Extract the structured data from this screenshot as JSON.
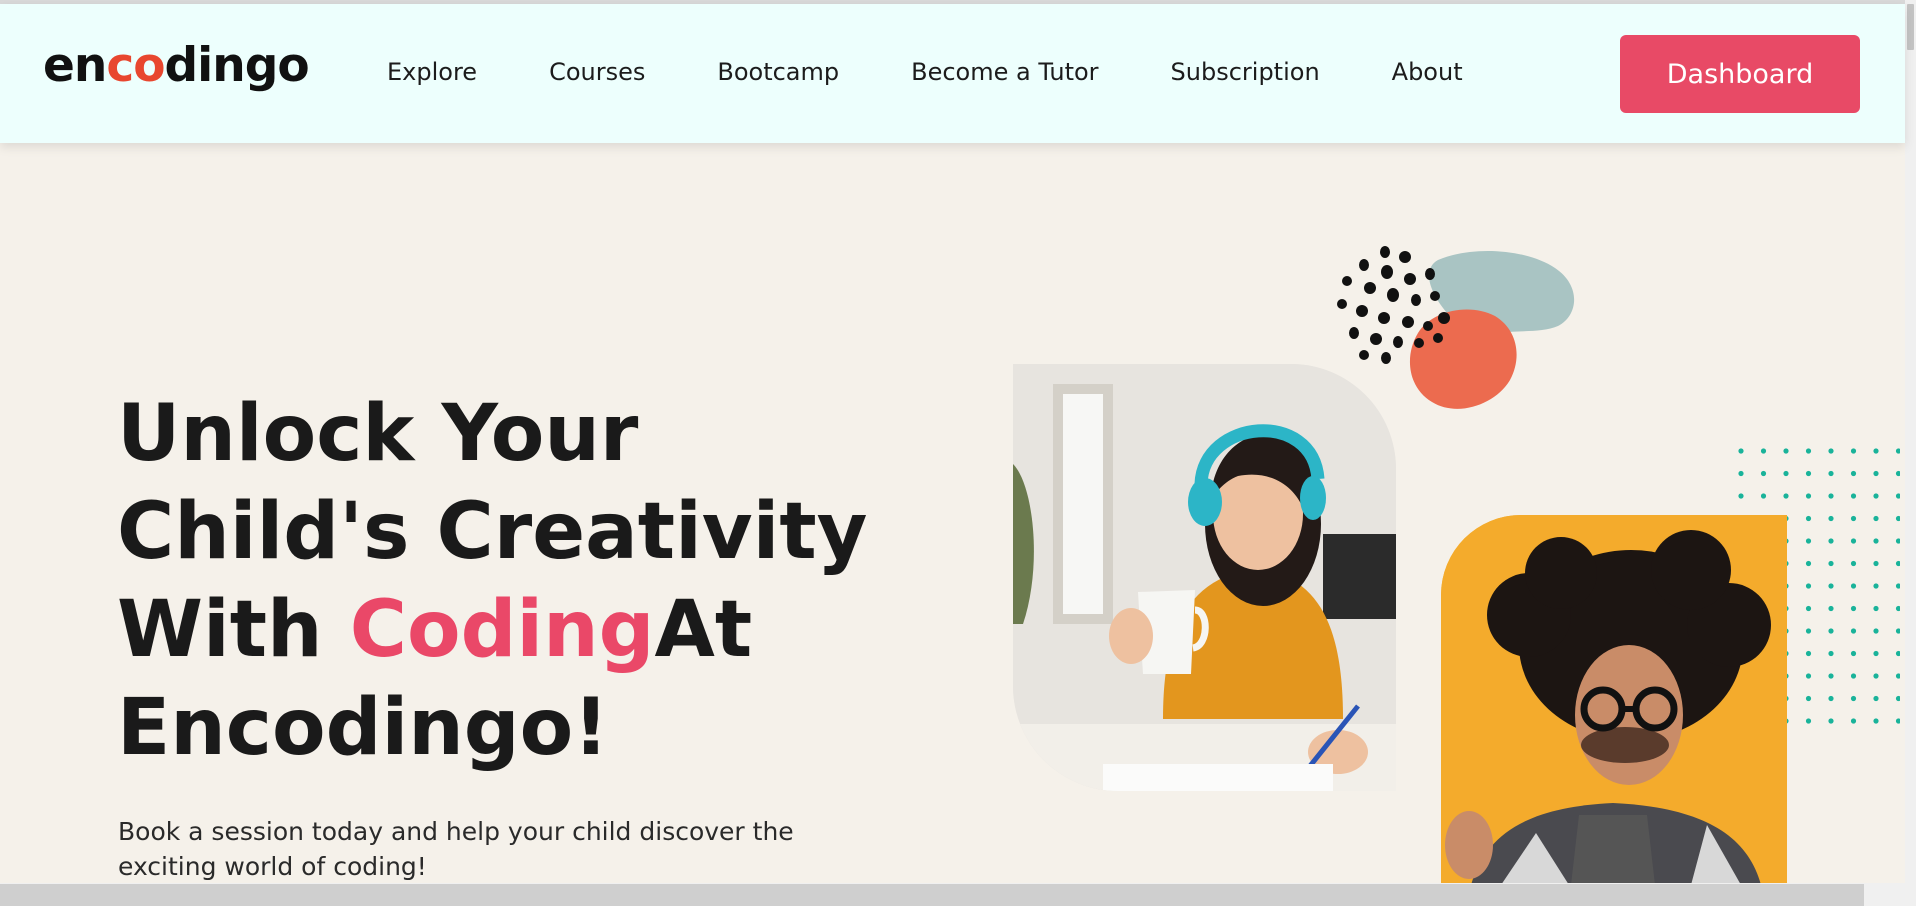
{
  "brand": {
    "logo_prefix": "en",
    "logo_accent": "co",
    "logo_suffix": "dingo",
    "accent_color": "#e8472f"
  },
  "nav": {
    "items": [
      {
        "label": "Explore"
      },
      {
        "label": "Courses"
      },
      {
        "label": "Bootcamp"
      },
      {
        "label": "Become a Tutor"
      },
      {
        "label": "Subscription"
      },
      {
        "label": "About"
      }
    ],
    "cta_label": "Dashboard",
    "cta_color": "#e84a66"
  },
  "hero": {
    "line1": "Unlock Your",
    "line2": "Child's Creativity",
    "line3_prefix": "With ",
    "line3_highlight": "Coding",
    "line3_suffix": "At",
    "line4": "Encodingo!",
    "highlight_color": "#ea4868",
    "subtitle": "Book a session today and help your child discover the exciting world of coding!"
  },
  "images": {
    "student_icon": "girl-with-headphones-image",
    "thinker_icon": "curly-hair-man-image"
  },
  "colors": {
    "header_bg": "#edfffd",
    "page_bg": "#f5f1ea",
    "blob_teal": "#a9c4c3",
    "blob_coral": "#ec6b4f",
    "dots_teal": "#19b39a",
    "yellow_bg": "#f4ab2c"
  }
}
